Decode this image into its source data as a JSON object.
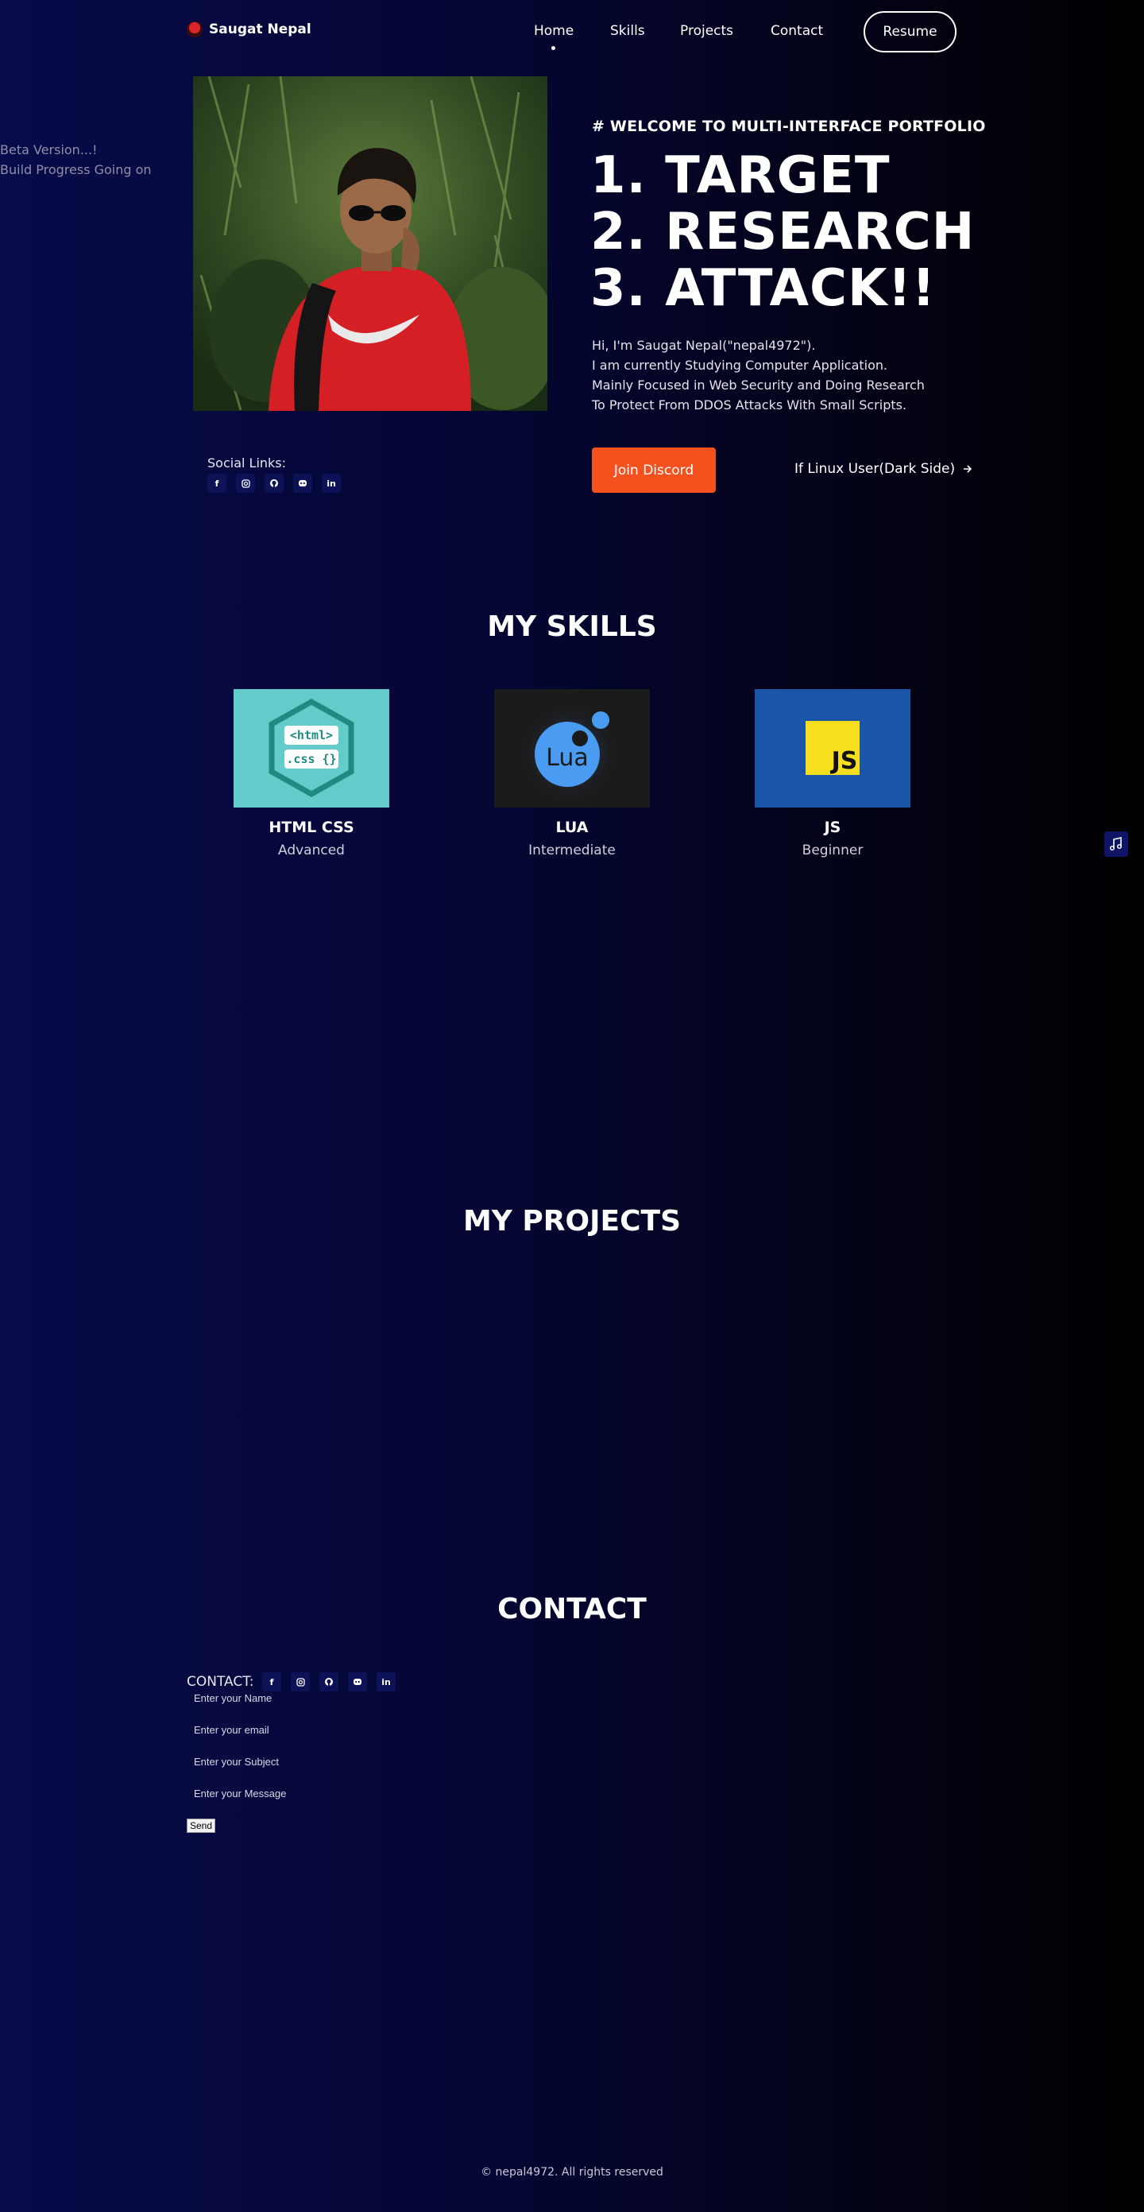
{
  "nav": {
    "brand": "Saugat Nepal",
    "links": [
      "Home",
      "Skills",
      "Projects",
      "Contact"
    ],
    "resume": "Resume"
  },
  "beta": {
    "line1": "Beta Version...!",
    "line2": "Build Progress Going on"
  },
  "hero": {
    "welcome": "# WELCOME TO MULTI-INTERFACE PORTFOLIO",
    "headline": [
      "1. TARGET",
      "2. RESEARCH",
      "3. ATTACK!!"
    ],
    "intro": [
      "Hi, I'm Saugat Nepal(\"nepal4972\").",
      "I am currently Studying Computer Application.",
      "Mainly Focused in Web Security and Doing Research",
      "To Protect From DDOS Attacks With Small Scripts."
    ],
    "discord": "Join Discord",
    "linux": "If Linux User(Dark Side)",
    "social_label": "Social Links:"
  },
  "social_icons": [
    "facebook-icon",
    "instagram-icon",
    "github-icon",
    "discord-icon",
    "linkedin-icon"
  ],
  "skills": {
    "title": "MY SKILLS",
    "items": [
      {
        "name": "HTML CSS",
        "level": "Advanced",
        "badge_top": "<html>",
        "badge_bottom": ".css {}"
      },
      {
        "name": "LUA",
        "level": "Intermediate",
        "badge": "Lua"
      },
      {
        "name": "JS",
        "level": "Beginner",
        "badge": "JS"
      }
    ]
  },
  "projects": {
    "title": "MY PROJECTS"
  },
  "contact": {
    "title": "CONTACT",
    "label": "CONTACT:",
    "name_placeholder": "Enter your Name",
    "email_placeholder": "Enter your email",
    "subject_placeholder": "Enter your Subject",
    "message_placeholder": "Enter your Message",
    "send": "Send"
  },
  "footer": "© nepal4972. All rights reserved",
  "colors": {
    "accent": "#f4511e",
    "icon_bg": "#0d1155",
    "html_bg": "#63ccca",
    "lua_bg": "#1b1b1b",
    "js_bg": "#1a55a8",
    "js_yellow": "#f7df1e"
  }
}
